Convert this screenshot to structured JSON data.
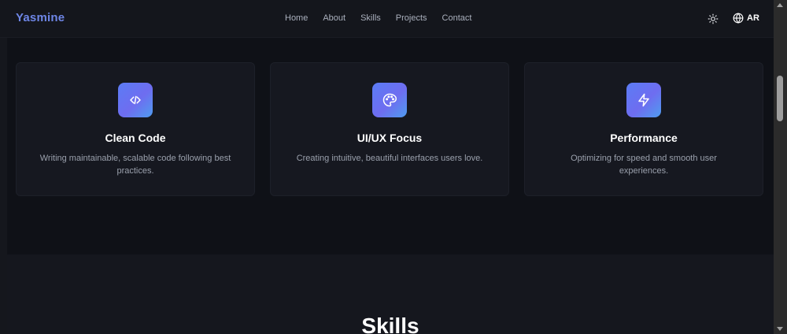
{
  "header": {
    "logo": "Yasmine",
    "nav": [
      "Home",
      "About",
      "Skills",
      "Projects",
      "Contact"
    ],
    "theme_icon": "sun-icon",
    "language_icon": "globe-icon",
    "language_label": "AR"
  },
  "features": [
    {
      "icon": "code-icon",
      "title": "Clean Code",
      "description": "Writing maintainable, scalable code following best practices."
    },
    {
      "icon": "palette-icon",
      "title": "UI/UX Focus",
      "description": "Creating intuitive, beautiful interfaces users love."
    },
    {
      "icon": "lightning-icon",
      "title": "Performance",
      "description": "Optimizing for speed and smooth user experiences."
    }
  ],
  "skills": {
    "title": "Skills"
  },
  "colors": {
    "accent": "#6e86e6",
    "background": "#0f1117",
    "card": "#161820"
  }
}
